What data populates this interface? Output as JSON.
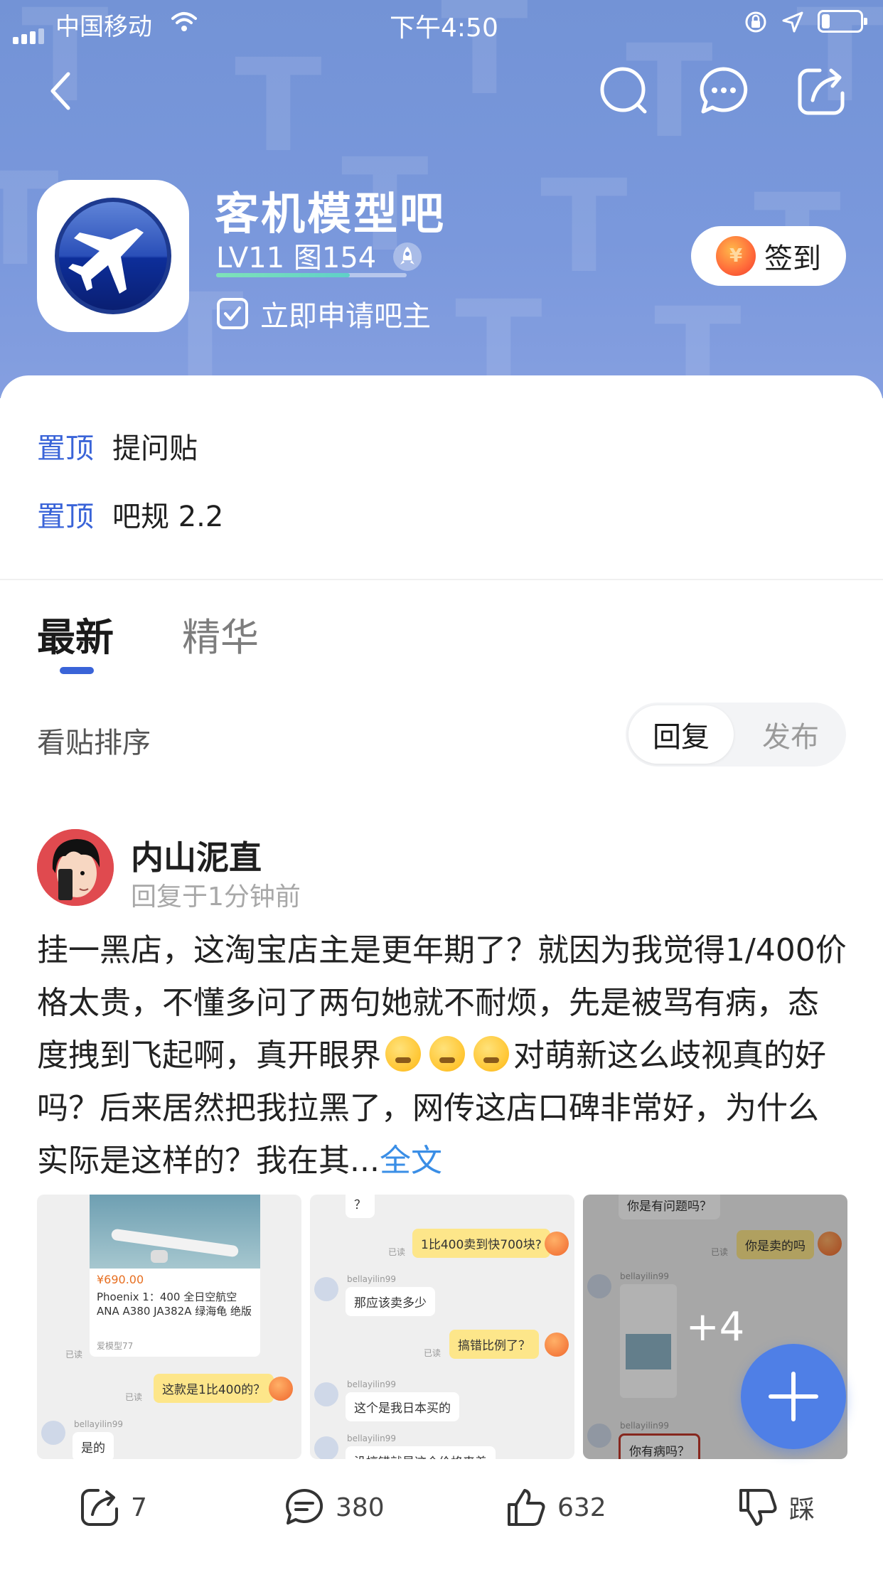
{
  "status_bar": {
    "carrier": "中国移动",
    "time": "下午4:50",
    "battery_level": 0.3
  },
  "nav": {
    "back_icon": "chevron-left-icon",
    "search_icon": "search-icon",
    "message_icon": "chat-bubble-icon",
    "share_icon": "share-icon"
  },
  "forum": {
    "title": "客机模型吧",
    "level": "LV11 图154",
    "level_progress": 0.7,
    "apply_owner": "立即申请吧主",
    "checkin_label": "签到",
    "coin_symbol": "¥"
  },
  "pinned": [
    {
      "tag": "置顶",
      "title": "提问贴"
    },
    {
      "tag": "置顶",
      "title": "吧规 2.2"
    }
  ],
  "tabs": [
    {
      "label": "最新",
      "active": true
    },
    {
      "label": "精华",
      "active": false
    }
  ],
  "sort": {
    "label": "看贴排序",
    "options": [
      "回复",
      "发布"
    ],
    "selected": "回复"
  },
  "post": {
    "author": "内山泥直",
    "time": "回复于1分钟前",
    "body_part1": "挂一黑店，这淘宝店主是更年期了？就因为我觉得1/400价格太贵，不懂多问了两句她就不耐烦，先是被骂有病，态度拽到飞起啊，真开眼界",
    "body_part2": "对萌新这么歧视真的好吗？后来居然把我拉黑了，网传这店口碑非常好，为什么实际是这样的？我在其...",
    "more_label": "全文",
    "image_more_count": "+4",
    "thumb1": {
      "price": "¥690.00",
      "product": "Phoenix 1：400 全日空航空 ANA A380 JA382A 绿海龟 绝版",
      "shop": "爱模型77",
      "read": "已读",
      "msg_me": "这款是1比400的？",
      "user": "bellayilin99",
      "msg_other": "是的"
    },
    "thumb2": {
      "q": "？",
      "read": "已读",
      "msg_me1": "1比400卖到快700块?",
      "user": "bellayilin99",
      "msg_other1": "那应该卖多少",
      "msg_me2": "搞错比例了？",
      "msg_other2": "这个是我日本买的",
      "msg_other3": "没搞错就是这个价格来着"
    },
    "thumb3": {
      "msg_other_top": "你是有问题吗？",
      "read": "已读",
      "msg_me": "你是卖的吗",
      "user": "bellayilin99",
      "msg_other": "你有病吗？"
    }
  },
  "actions": {
    "share_count": "7",
    "comment_count": "380",
    "like_count": "632",
    "dislike_label": "踩"
  },
  "colors": {
    "accent_blue": "#3a64d8",
    "header_bg": "#7393d6",
    "link_blue": "#3a8ee6",
    "fab_blue": "#4f7fe6"
  }
}
